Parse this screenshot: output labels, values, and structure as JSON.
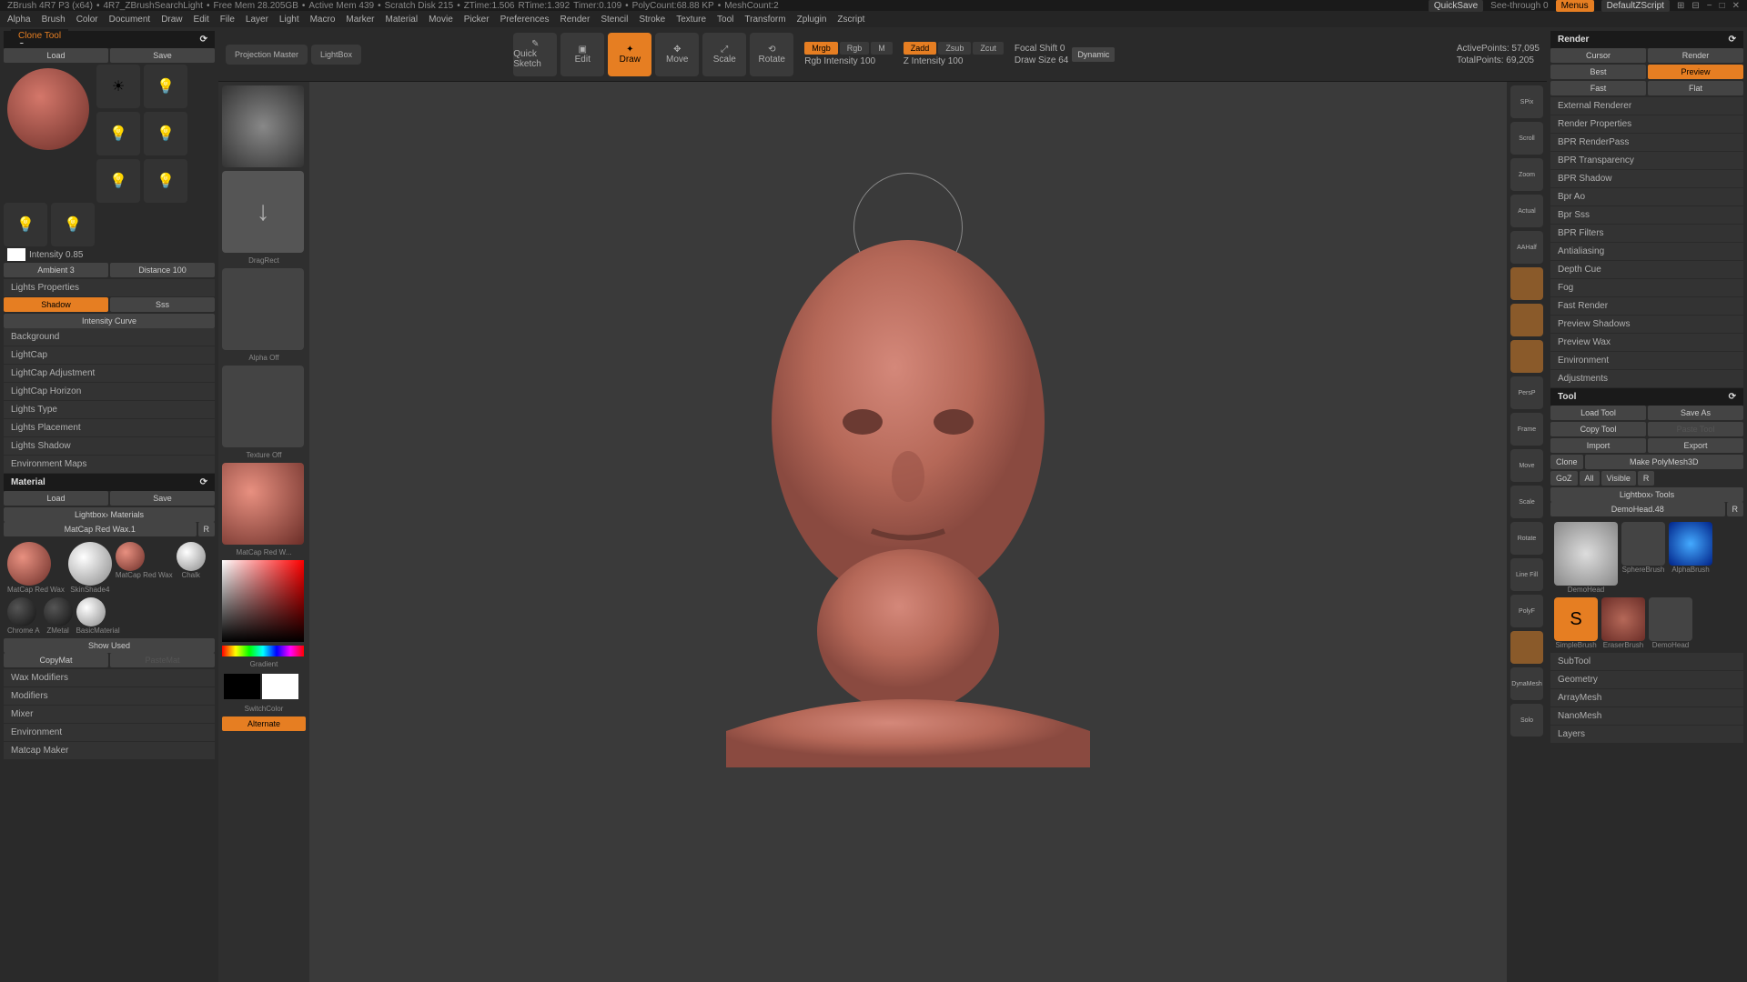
{
  "topbar": {
    "app": "ZBrush 4R7 P3 (x64)",
    "project": "4R7_ZBrushSearchLight",
    "freemem": "Free Mem 28.205GB",
    "activemem": "Active Mem 439",
    "scratch": "Scratch Disk 215",
    "ztime": "ZTime:1.506",
    "rtime": "RTime:1.392",
    "timer": "Timer:0.109",
    "polycount": "PolyCount:68.88 KP",
    "meshcount": "MeshCount:2",
    "quicksave": "QuickSave",
    "seethrough": "See-through  0",
    "menus": "Menus",
    "layout": "DefaultZScript"
  },
  "menu": [
    "Alpha",
    "Brush",
    "Color",
    "Document",
    "Draw",
    "Edit",
    "File",
    "Layer",
    "Light",
    "Macro",
    "Marker",
    "Material",
    "Movie",
    "Picker",
    "Preferences",
    "Render",
    "Stencil",
    "Stroke",
    "Texture",
    "Tool",
    "Transform",
    "Zplugin",
    "Zscript"
  ],
  "tooltip": "Clone Tool",
  "light": {
    "title": "Light",
    "load": "Load",
    "save": "Save",
    "intensity_label": "Intensity 0.85",
    "ambient": "Ambient 3",
    "distance": "Distance 100",
    "props": "Lights Properties",
    "shadow": "Shadow",
    "sss": "Sss",
    "curve": "Intensity Curve",
    "sections": [
      "Background",
      "LightCap",
      "LightCap Adjustment",
      "LightCap Horizon",
      "Lights Type",
      "Lights Placement",
      "Lights Shadow",
      "Environment Maps"
    ]
  },
  "material": {
    "title": "Material",
    "load": "Load",
    "save": "Save",
    "lightbox": "Lightbox› Materials",
    "current": "MatCap Red Wax.1",
    "r": "R",
    "mats": [
      "MatCap Red Wax",
      "SkinShade4",
      "MatCap Red Wax",
      "Chalk",
      "Chrome A",
      "ZMetal",
      "BasicMaterial"
    ],
    "show_used": "Show Used",
    "copymat": "CopyMat",
    "pastemat": "PasteMat",
    "sections": [
      "Wax Modifiers",
      "Modifiers",
      "Mixer",
      "Environment",
      "Matcap Maker"
    ]
  },
  "toolbar": {
    "projection": "Projection Master",
    "lightbox": "LightBox",
    "quicksketch": "Quick Sketch",
    "edit": "Edit",
    "draw": "Draw",
    "move": "Move",
    "scale": "Scale",
    "rotate": "Rotate",
    "mrgb": "Mrgb",
    "rgb": "Rgb",
    "m": "M",
    "rgb_intensity": "Rgb Intensity 100",
    "zadd": "Zadd",
    "zsub": "Zsub",
    "zcut": "Zcut",
    "z_intensity": "Z Intensity 100",
    "focal": "Focal Shift 0",
    "drawsize": "Draw Size 64",
    "dynamic": "Dynamic",
    "active_pts": "ActivePoints: 57,095",
    "total_pts": "TotalPoints: 69,205"
  },
  "viewport_left": {
    "dragrect": "DragRect",
    "alpha_off": "Alpha Off",
    "texture_off": "Texture Off",
    "matcap": "MatCap Red W...",
    "gradient": "Gradient",
    "switchcolor": "SwitchColor",
    "alternate": "Alternate"
  },
  "viewport_side": [
    "SPix",
    "Scroll",
    "Zoom",
    "Actual",
    "AAHalf",
    "",
    "",
    "",
    "",
    "",
    "PersP",
    "",
    "Frame",
    "Move",
    "Scale",
    "Rotate",
    "Line Fill",
    "PolyF",
    "",
    "DynaMesh",
    "",
    "Solo"
  ],
  "render": {
    "title": "Render",
    "cursor": "Cursor",
    "render": "Render",
    "best": "Best",
    "preview": "Preview",
    "fast": "Fast",
    "flat": "Flat",
    "sections": [
      "External Renderer",
      "Render Properties",
      "BPR RenderPass",
      "BPR Transparency",
      "BPR Shadow",
      "Bpr Ao",
      "Bpr Sss",
      "BPR Filters",
      "Antialiasing",
      "Depth Cue",
      "Fog",
      "Fast Render",
      "Preview Shadows",
      "Preview Wax",
      "Environment",
      "Adjustments"
    ]
  },
  "tool": {
    "title": "Tool",
    "load": "Load Tool",
    "saveas": "Save As",
    "copy": "Copy Tool",
    "paste": "Paste Tool",
    "import": "Import",
    "export": "Export",
    "clone": "Clone",
    "make": "Make PolyMesh3D",
    "goz": "GoZ",
    "all": "All",
    "visible": "Visible",
    "r": "R",
    "lightbox": "Lightbox› Tools",
    "active": "DemoHead.48",
    "tools": [
      "DemoHead",
      "SphereBrush",
      "AlphaBrush",
      "SimpleBrush",
      "EraserBrush",
      "DemoHead"
    ],
    "sections": [
      "SubTool",
      "Geometry",
      "ArrayMesh",
      "NanoMesh",
      "Layers"
    ]
  }
}
